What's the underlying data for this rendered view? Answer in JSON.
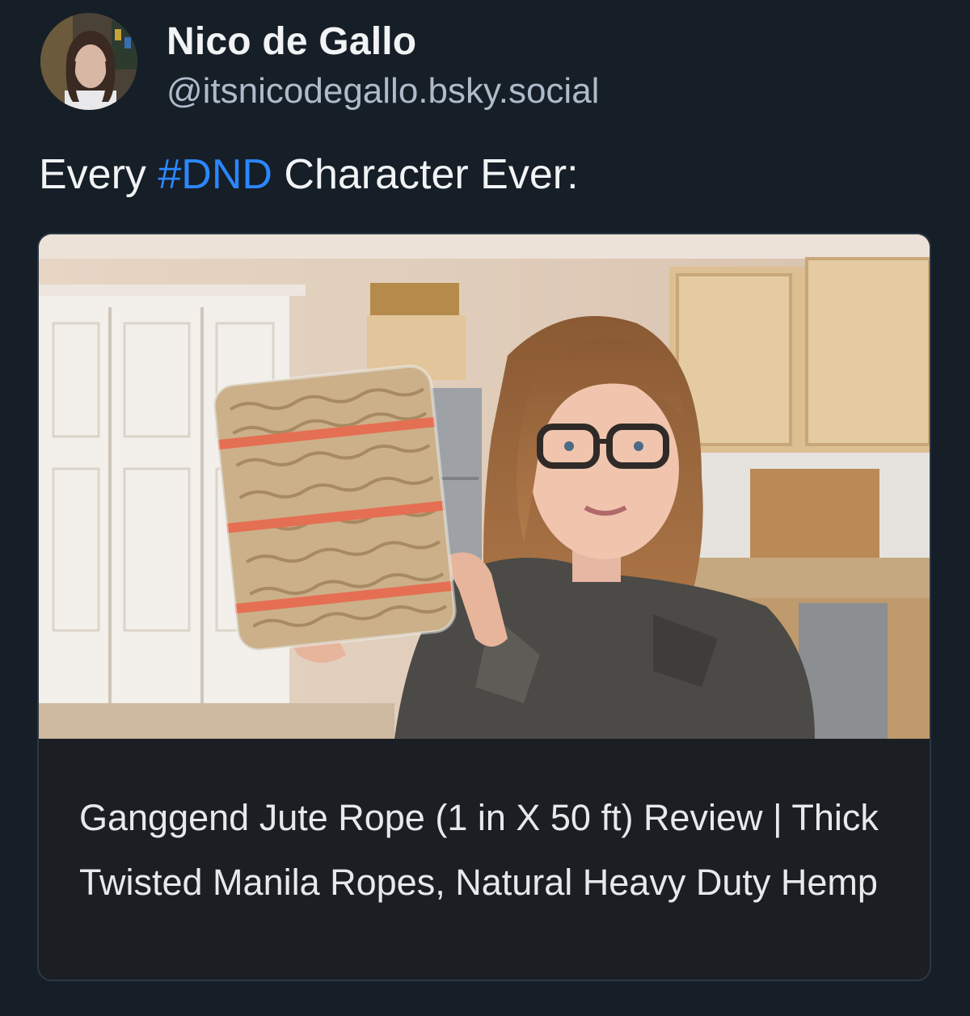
{
  "author": {
    "display_name": "Nico de Gallo",
    "handle": "@itsnicodegallo.bsky.social",
    "avatar_icon": "profile-photo"
  },
  "post": {
    "text_before": "Every ",
    "hashtag": "#DND",
    "text_after": " Character Ever:"
  },
  "embed": {
    "title": "Ganggend Jute Rope (1 in X 50 ft) Review | Thick Twisted Manila Ropes, Natural Heavy Duty Hemp",
    "thumbnail_icon": "video-thumbnail-woman-holding-jute-rope"
  },
  "colors": {
    "background": "#161e27",
    "hashtag": "#2b87ff",
    "handle": "#aebbc9",
    "card_border": "#2c3845",
    "card_info_bg": "#1b1f24"
  }
}
